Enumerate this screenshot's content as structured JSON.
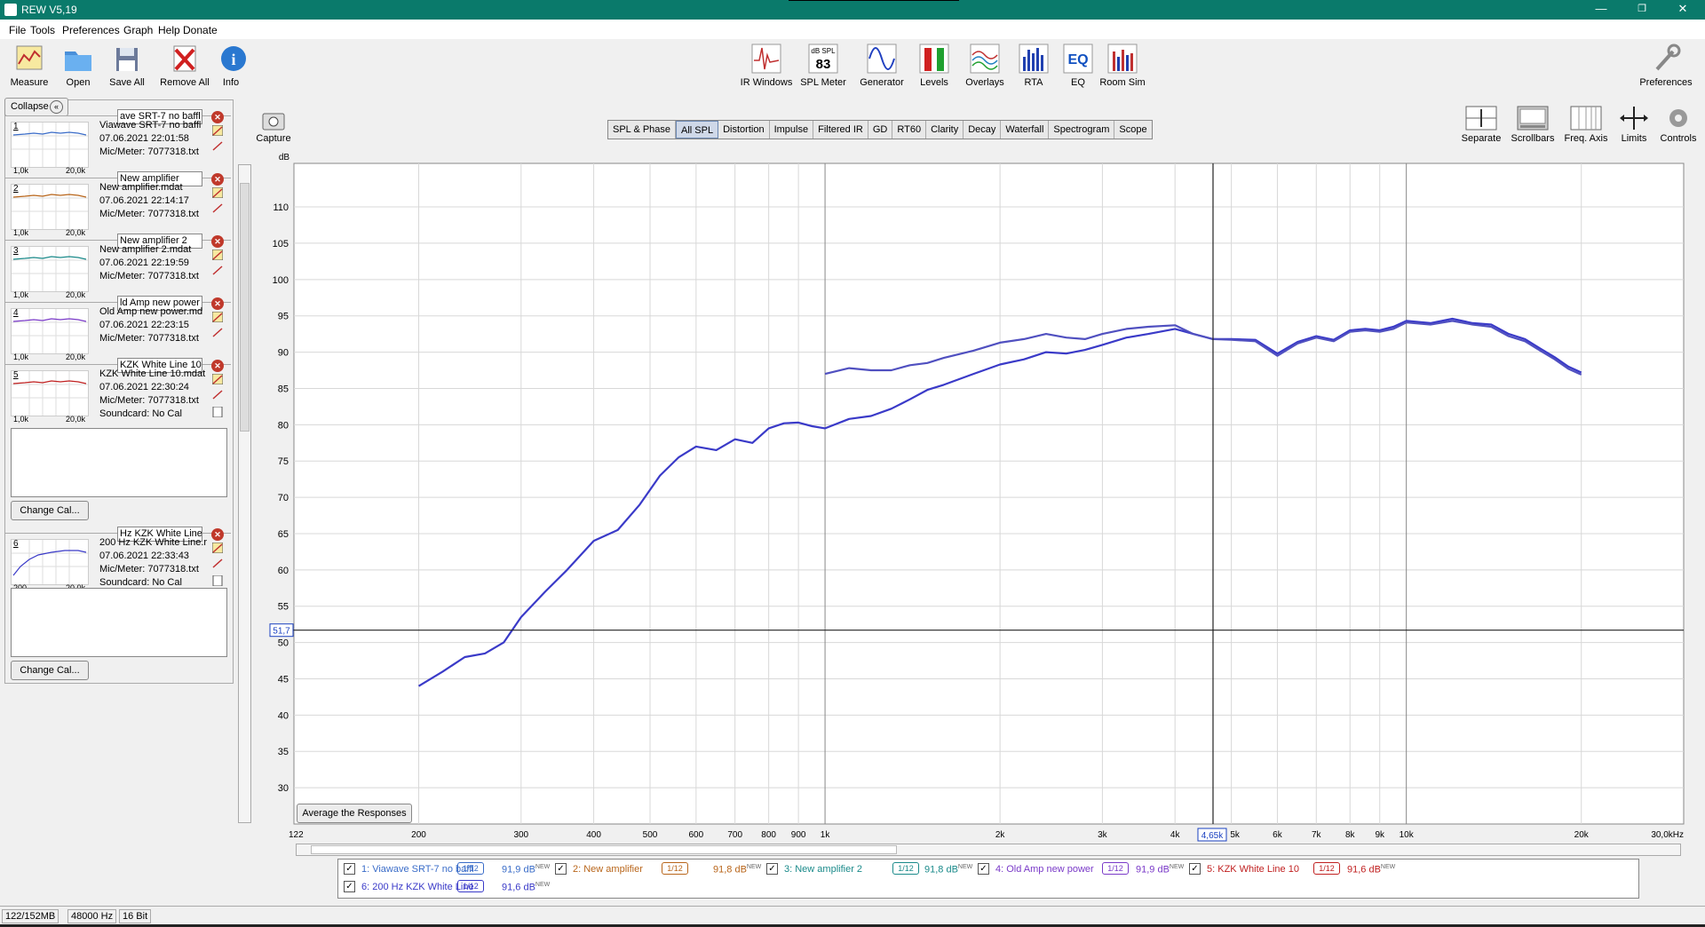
{
  "window": {
    "title": "REW V5,19",
    "minimize": "—",
    "restore": "❐",
    "close": "✕"
  },
  "menu": [
    "File",
    "Tools",
    "Preferences",
    "Graph",
    "Help",
    "Donate"
  ],
  "toolbar_left": [
    {
      "label": "Measure",
      "icon": "measure-icon"
    },
    {
      "label": "Open",
      "icon": "folder-icon"
    },
    {
      "label": "Save All",
      "icon": "save-icon"
    },
    {
      "label": "Remove All",
      "icon": "remove-icon"
    },
    {
      "label": "Info",
      "icon": "info-icon"
    }
  ],
  "toolbar_center": [
    {
      "label": "IR Windows",
      "icon": "ir-windows-icon"
    },
    {
      "label": "SPL Meter",
      "icon": "spl-meter-icon",
      "top": "dB SPL",
      "value": "83"
    },
    {
      "label": "Generator",
      "icon": "generator-icon"
    },
    {
      "label": "Levels",
      "icon": "levels-icon"
    },
    {
      "label": "Overlays",
      "icon": "overlays-icon"
    },
    {
      "label": "RTA",
      "icon": "rta-icon"
    },
    {
      "label": "EQ",
      "icon": "eq-icon"
    },
    {
      "label": "Room Sim",
      "icon": "room-sim-icon"
    }
  ],
  "preferences": "Preferences",
  "capture": "Capture",
  "graph_controls": [
    "Separate",
    "Scrollbars",
    "Freq. Axis",
    "Limits",
    "Controls"
  ],
  "tabs": [
    "SPL & Phase",
    "All SPL",
    "Distortion",
    "Impulse",
    "Filtered IR",
    "GD",
    "RT60",
    "Clarity",
    "Decay",
    "Waterfall",
    "Spectrogram",
    "Scope"
  ],
  "active_tab": "All SPL",
  "collapse_label": "Collapse",
  "measurements": [
    {
      "num": "1",
      "name_field": "ave SRT-7 no baffl",
      "file": "Viawave SRT-7 no baffl",
      "date": "07.06.2021 22:01:58",
      "mic": "Mic/Meter: 7077318.txt",
      "lo": "1,0k",
      "hi": "20,0k",
      "color": "#3a6cc8"
    },
    {
      "num": "2",
      "name_field": "New amplifier",
      "file": "New amplifier.mdat",
      "date": "07.06.2021 22:14:17",
      "mic": "Mic/Meter: 7077318.txt",
      "lo": "1,0k",
      "hi": "20,0k",
      "color": "#b8651a"
    },
    {
      "num": "3",
      "name_field": "New amplifier 2",
      "file": "New amplifier 2.mdat",
      "date": "07.06.2021 22:19:59",
      "mic": "Mic/Meter: 7077318.txt",
      "lo": "1,0k",
      "hi": "20,0k",
      "color": "#1a8a8a"
    },
    {
      "num": "4",
      "name_field": "ld Amp new power",
      "file": "Old Amp new power.md",
      "date": "07.06.2021 22:23:15",
      "mic": "Mic/Meter: 7077318.txt",
      "lo": "1,0k",
      "hi": "20,0k",
      "color": "#7a3ac8"
    },
    {
      "num": "5",
      "name_field": "KZK White Line 10",
      "file": "KZK White Line 10.mdat",
      "date": "07.06.2021 22:30:24",
      "mic": "Mic/Meter: 7077318.txt",
      "soundcard": "Soundcard: No Cal",
      "lo": "1,0k",
      "hi": "20,0k",
      "color": "#c02020"
    },
    {
      "num": "6",
      "name_field": "Hz KZK White Line",
      "file": "200 Hz KZK White Line.r",
      "date": "07.06.2021 22:33:43",
      "mic": "Mic/Meter: 7077318.txt",
      "soundcard": "Soundcard: No Cal",
      "lo": "200",
      "hi": "20,0k",
      "color": "#3a3ac8"
    }
  ],
  "change_cal": "Change Cal...",
  "average_button": "Average the Responses",
  "cursor": {
    "y_readout": "51,7",
    "x_readout": "4,65k"
  },
  "axis": {
    "y_unit": "dB",
    "x_unit": "Hz"
  },
  "legend": [
    {
      "name": "1: Viawave SRT-7 no baffl",
      "smoothing": "1/12",
      "value": "91,9 dB",
      "tag": "NEW",
      "color": "#3a6cc8"
    },
    {
      "name": "2: New amplifier",
      "smoothing": "1/12",
      "value": "91,8 dB",
      "tag": "NEW",
      "color": "#b8651a"
    },
    {
      "name": "3: New amplifier 2",
      "smoothing": "1/12",
      "value": "91,8 dB",
      "tag": "NEW",
      "color": "#1a8a8a"
    },
    {
      "name": "4: Old Amp new power",
      "smoothing": "1/12",
      "value": "91,9 dB",
      "tag": "NEW",
      "color": "#7a3ac8"
    },
    {
      "name": "5: KZK White Line 10",
      "smoothing": "1/12",
      "value": "91,6 dB",
      "tag": "NEW",
      "color": "#c02020"
    },
    {
      "name": "6: 200 Hz KZK White Line",
      "smoothing": "1/12",
      "value": "91,6 dB",
      "tag": "NEW",
      "color": "#3a3ac8"
    }
  ],
  "status": [
    "122/152MB",
    "48000 Hz",
    "16 Bit"
  ],
  "chart_data": {
    "type": "line",
    "xlabel": "Hz",
    "ylabel": "dB",
    "x_scale": "log",
    "xlim": [
      122,
      30000
    ],
    "ylim": [
      25,
      116
    ],
    "x_ticks": [
      122,
      200,
      300,
      400,
      500,
      600,
      700,
      800,
      900,
      1000,
      2000,
      3000,
      4000,
      5000,
      6000,
      7000,
      8000,
      9000,
      10000,
      20000,
      30000
    ],
    "x_tick_labels": [
      "122",
      "200",
      "300",
      "400",
      "500",
      "600",
      "700",
      "800",
      "900",
      "1k",
      "2k",
      "3k",
      "4k",
      "5k",
      "6k",
      "7k",
      "8k",
      "9k",
      "10k",
      "20k",
      "30,0kHz"
    ],
    "y_ticks": [
      30,
      35,
      40,
      45,
      50,
      55,
      60,
      65,
      70,
      75,
      80,
      85,
      90,
      95,
      100,
      105,
      110
    ],
    "cursor_x": 4650,
    "cursor_y": 51.7,
    "series": [
      {
        "name": "6: 200 Hz KZK White Line",
        "color": "#3a3ac8",
        "x": [
          200,
          220,
          240,
          260,
          280,
          300,
          330,
          360,
          400,
          440,
          480,
          520,
          560,
          600,
          650,
          700,
          750,
          800,
          850,
          900,
          950,
          1000,
          1100,
          1200,
          1300,
          1400,
          1500,
          1600,
          1800,
          2000,
          2200,
          2400,
          2600,
          2800,
          3000,
          3300,
          3600,
          4000,
          4300,
          4650,
          5000,
          5500,
          6000,
          6500,
          7000,
          7500,
          8000,
          8500,
          9000,
          9500,
          10000,
          11000,
          12000,
          13000,
          14000,
          15000,
          16000,
          17000,
          18000,
          19000,
          20000
        ],
        "y": [
          44,
          46,
          48,
          48.5,
          50,
          53.5,
          57,
          60,
          64,
          65.5,
          69,
          73,
          75.5,
          77,
          76.5,
          78,
          77.5,
          79.5,
          80.2,
          80.3,
          79.8,
          79.5,
          80.8,
          81.2,
          82.2,
          83.5,
          84.8,
          85.5,
          87,
          88.3,
          89,
          90,
          89.8,
          90.3,
          91,
          92,
          92.5,
          93.2,
          92.5,
          91.8,
          91.8,
          91.7,
          89.8,
          91.4,
          92.2,
          91.7,
          93,
          93.2,
          93,
          93.5,
          94.3,
          94,
          94.6,
          94,
          93.8,
          92.5,
          91.8,
          90.5,
          89.3,
          88,
          87.2
        ]
      },
      {
        "name": "5: KZK White Line 10",
        "color": "#5050c0",
        "x": [
          1000,
          1100,
          1200,
          1300,
          1400,
          1500,
          1600,
          1800,
          2000,
          2200,
          2400,
          2600,
          2800,
          3000,
          3300,
          3600,
          4000,
          4300,
          4650,
          5000,
          5500,
          6000,
          6500,
          7000,
          7500,
          8000,
          8500,
          9000,
          9500,
          10000,
          11000,
          12000,
          13000,
          14000,
          15000,
          16000,
          17000,
          18000,
          19000,
          20000
        ],
        "y": [
          87,
          87.8,
          87.5,
          87.5,
          88.2,
          88.5,
          89.2,
          90.2,
          91.3,
          91.8,
          92.5,
          92,
          91.8,
          92.5,
          93.2,
          93.5,
          93.7,
          92.5,
          91.8,
          91.7,
          91.5,
          89.5,
          91.2,
          92,
          91.5,
          92.8,
          93,
          92.8,
          93.2,
          94.1,
          93.8,
          94.3,
          93.8,
          93.5,
          92.2,
          91.5,
          90.2,
          89,
          87.7,
          86.9
        ]
      }
    ]
  }
}
